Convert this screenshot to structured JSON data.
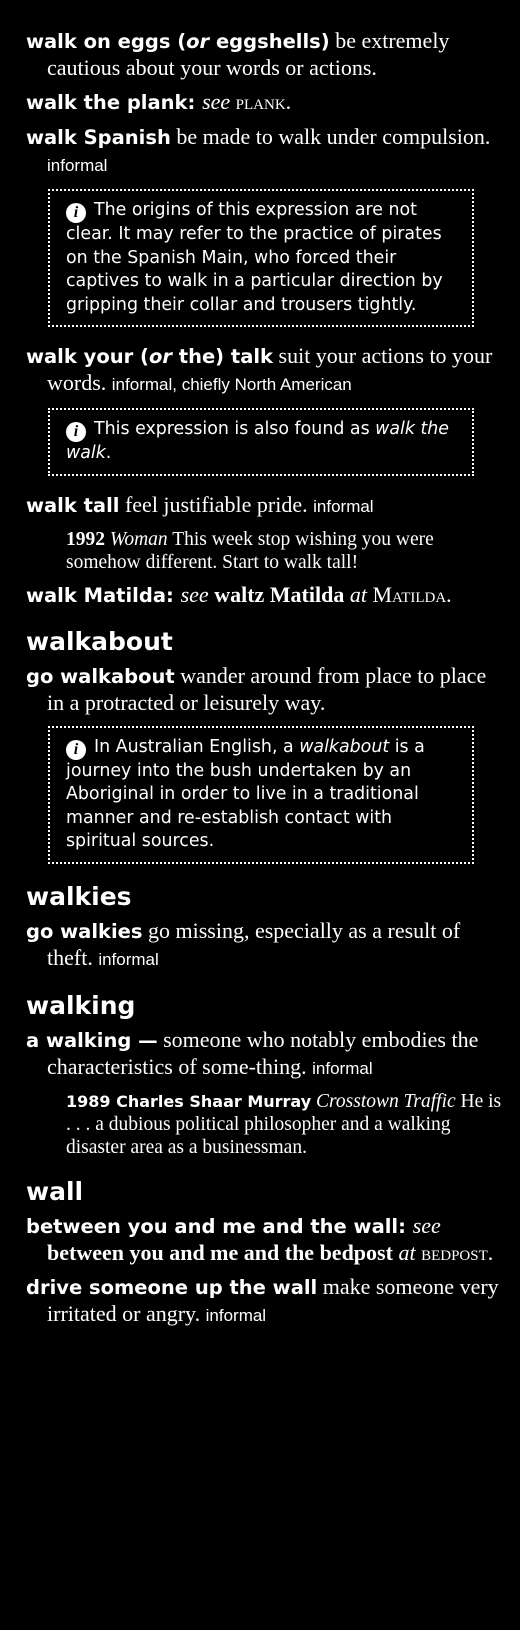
{
  "entries_a": [
    {
      "phrase": "walk on eggs (",
      "phrase_or": "or",
      "phrase_b": " eggshells)",
      "def": " be extremely cautious about your words or actions."
    },
    {
      "phrase": "walk the plank",
      "see": "see",
      "target": "plank."
    },
    {
      "phrase": "walk Spanish",
      "def": " be made to walk under compulsion.",
      "label": "informal"
    }
  ],
  "note1": "The origins of this expression are not clear. It may refer to the practice of pirates on the Spanish Main, who forced their captives to walk in a particular direction by gripping their collar and trousers tightly.",
  "entry_talk": {
    "phrase": "walk your (",
    "phrase_or": "or",
    "phrase_b": " the) talk",
    "def": " suit your actions to your words.",
    "label": "informal, chiefly North American"
  },
  "note2": {
    "text": "This expression is also found as ",
    "italic": "walk the walk",
    "end": "."
  },
  "entry_tall": {
    "phrase": "walk tall",
    "def": " feel justifiable pride.",
    "label": "informal"
  },
  "quote_tall": {
    "year": "1992",
    "source": "Woman",
    "text": " This week stop wishing you were somehow different. Start to walk tall!"
  },
  "entry_matilda": {
    "phrase": "walk Matilda",
    "see": "see",
    "bold": "waltz Matilda",
    "at": "at",
    "target": "Matilda."
  },
  "headword_walkabout": "walkabout",
  "entry_walkabout": {
    "phrase": "go walkabout",
    "def": " wander around from place to place in a protracted or leisurely way."
  },
  "note3": {
    "text": "In Australian English, a ",
    "italic": "walkabout",
    "end": " is a journey into the bush undertaken by an Aboriginal in order to live in a traditional manner and re-establish contact with spiritual sources."
  },
  "headword_walkies": "walkies",
  "entry_walkies": {
    "phrase": "go walkies",
    "def": " go missing, especially as a result of theft.",
    "label": "informal"
  },
  "headword_walking": "walking",
  "entry_walking": {
    "phrase": "a walking —",
    "def": " someone who notably embodies the characteristics of some-thing.",
    "label": "informal"
  },
  "quote_walking": {
    "year": "1989 Charles Shaar Murray",
    "source": "Crosstown Traffic",
    "text": " He is . . . a dubious political philosopher and a walking disaster area as a businessman."
  },
  "headword_wall": "wall",
  "entry_between": {
    "phrase": "between you and me and the wall",
    "see": "see",
    "bold": "between you and me and the bedpost",
    "at": "at",
    "target": "bedpost."
  },
  "entry_drive": {
    "phrase": "drive someone up the wall",
    "def": " make someone very irritated or angry.",
    "label": "informal"
  }
}
